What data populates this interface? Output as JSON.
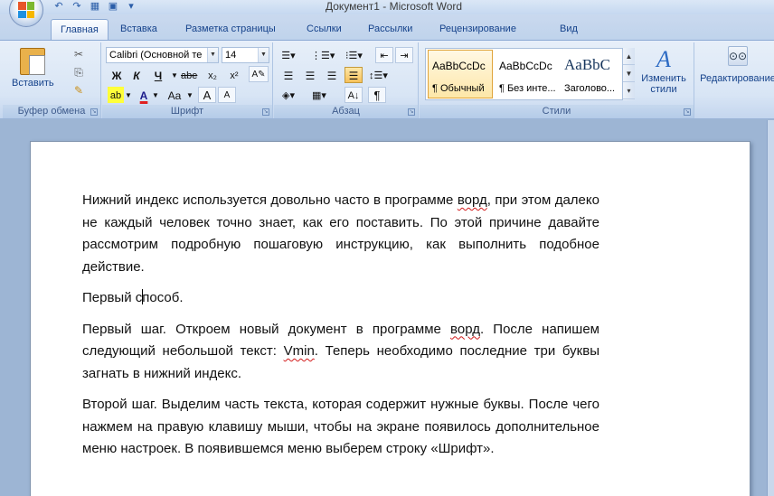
{
  "window": {
    "title": "Документ1 - Microsoft Word"
  },
  "quick_access": {
    "undo_icon": "undo-arrow",
    "redo_icon": "redo-arrow",
    "save_icon": "floppy-disk"
  },
  "tabs": [
    {
      "label": "Главная",
      "active": true
    },
    {
      "label": "Вставка"
    },
    {
      "label": "Разметка страницы"
    },
    {
      "label": "Ссылки"
    },
    {
      "label": "Рассылки"
    },
    {
      "label": "Рецензирование"
    },
    {
      "label": "Вид"
    }
  ],
  "ribbon": {
    "clipboard": {
      "label": "Буфер обмена",
      "paste_label": "Вставить"
    },
    "font": {
      "label": "Шрифт",
      "font_name": "Calibri (Основной те",
      "font_size": "14",
      "bold": "Ж",
      "italic": "К",
      "underline": "Ч",
      "strike": "abe",
      "subscript": "x₂",
      "superscript": "x²",
      "highlight": "ab",
      "font_color": "A",
      "change_case": "Aa",
      "grow": "A",
      "shrink": "A"
    },
    "paragraph": {
      "label": "Абзац",
      "show_marks": "¶"
    },
    "styles": {
      "label": "Стили",
      "items": [
        {
          "sample": "AaBbCcDc",
          "name": "¶ Обычный",
          "selected": true
        },
        {
          "sample": "AaBbCcDc",
          "name": "¶ Без инте..."
        },
        {
          "sample": "AaBbC",
          "name": "Заголово..."
        }
      ],
      "change_styles_label": "Изменить стили"
    },
    "editing": {
      "label": "Редактирование"
    }
  },
  "document": {
    "paragraphs": [
      {
        "before": "Нижний индекс используется довольно часто в программе ",
        "wavy": "ворд",
        "after": ", при этом далеко не каждый человек точно знает, как его поставить. По этой причине давайте рассмотрим подробную пошаговую инструкцию, как выполнить подобное действие."
      },
      {
        "before": "Первый с",
        "cursor": true,
        "after": "пособ."
      },
      {
        "before": "Первый шаг. Откроем новый документ в программе ",
        "wavy": "ворд",
        "after": ". После напишем следующий небольшой текст: ",
        "wavy2": "Vmin",
        "after2": ". Теперь необходимо последние три буквы загнать в нижний индекс."
      },
      {
        "before": "Второй шаг. Выделим часть текста, которая содержит нужные буквы. После чего нажмем на правую клавишу мыши, чтобы на экране появилось дополнительное меню настроек. В появившемся меню выберем строку «Шрифт»."
      }
    ]
  }
}
